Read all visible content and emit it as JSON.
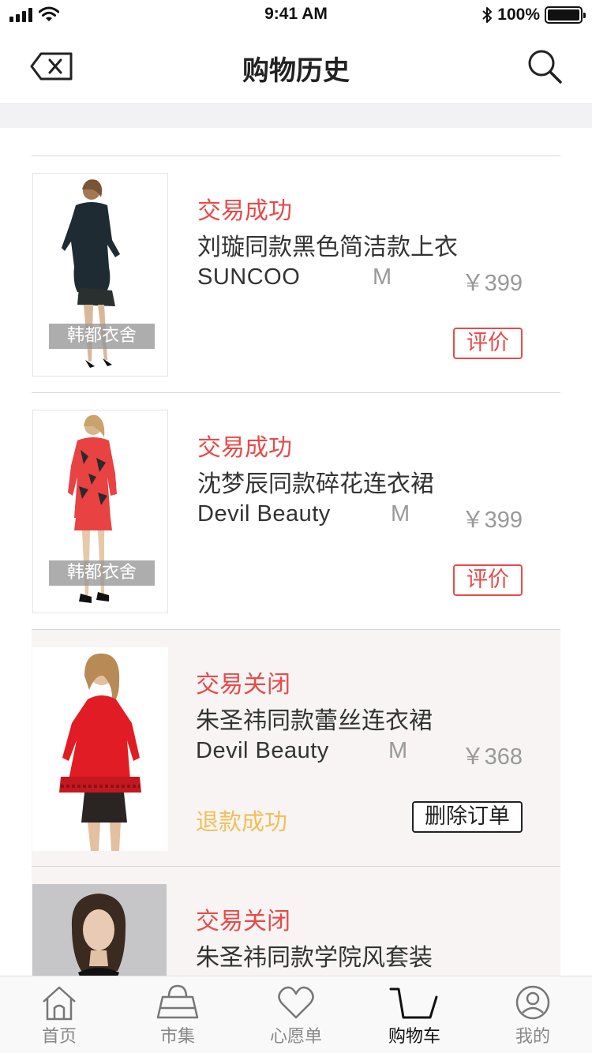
{
  "status_bar": {
    "time": "9:41 AM",
    "battery": "100%",
    "battery_level": 1.0
  },
  "header": {
    "title": "购物历史",
    "back_icon": "delete-back-icon",
    "search_icon": "search-icon"
  },
  "orders": [
    {
      "status": "交易成功",
      "name": "刘璇同款黑色简洁款上衣",
      "brand": "SUNCOO",
      "size": "M",
      "price": "￥399",
      "shop_tag": "韩都衣舍",
      "action": "评价",
      "state": "success"
    },
    {
      "status": "交易成功",
      "name": "沈梦辰同款碎花连衣裙",
      "brand": "Devil Beauty",
      "size": "M",
      "price": "￥399",
      "shop_tag": "韩都衣舍",
      "action": "评价",
      "state": "success"
    },
    {
      "status": "交易关闭",
      "name": "朱圣祎同款蕾丝连衣裙",
      "brand": "Devil Beauty",
      "size": "M",
      "price": "￥368",
      "refund": "退款成功",
      "action": "删除订单",
      "state": "closed"
    },
    {
      "status": "交易关闭",
      "name": "朱圣祎同款学院风套装",
      "state": "closed"
    }
  ],
  "tabs": [
    {
      "label": "首页",
      "icon": "home-icon"
    },
    {
      "label": "市集",
      "icon": "shopping-bag-icon"
    },
    {
      "label": "心愿单",
      "icon": "heart-icon"
    },
    {
      "label": "购物车",
      "icon": "cart-icon",
      "active": true
    },
    {
      "label": "我的",
      "icon": "user-icon"
    }
  ],
  "colors": {
    "accent_red": "#e84a4a",
    "refund_yellow": "#f0c05a",
    "closed_bg": "#f8f4f4"
  }
}
